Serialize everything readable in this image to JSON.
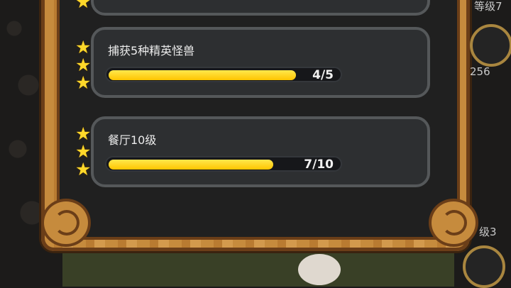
{
  "achievements": [
    {
      "title": "捕获5种精英怪兽",
      "progress_text": "4/5",
      "progress": 0.8
    },
    {
      "title": "餐厅10级",
      "progress_text": "7/10",
      "progress": 0.7
    }
  ],
  "side": {
    "level_top": "等级7",
    "score": "256",
    "level_bottom": "级3"
  }
}
